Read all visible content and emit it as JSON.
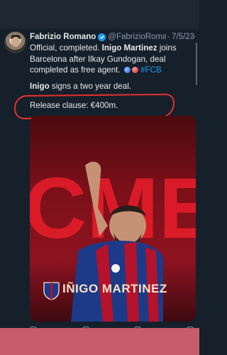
{
  "tweet": {
    "author_name": "Fabrizio Romano",
    "handle": "@FabrizioRoma...",
    "separator": "·",
    "date": "7/5/23",
    "more": "···",
    "line1_a": "Official, completed. ",
    "line1_b": "Inigo Martinez",
    "line1_c": " joins Barcelona after Ilkay Gundogan, deal completed as free agent.",
    "hashtag": "#FCB",
    "para2_bold": "Inigo",
    "para2_rest": " signs a two year deal.",
    "para3": "Release clause: €400m."
  },
  "media": {
    "graphic_letters": "CMER",
    "player_name": "IÑIGO MARTINEZ"
  },
  "actions": {
    "reply": "",
    "retweet": "",
    "like": "",
    "views": ""
  },
  "colors": {
    "background": "#15202b",
    "accent": "#1d9bf0",
    "annotation_red": "#e5312e",
    "footer": "#c75c6a"
  }
}
